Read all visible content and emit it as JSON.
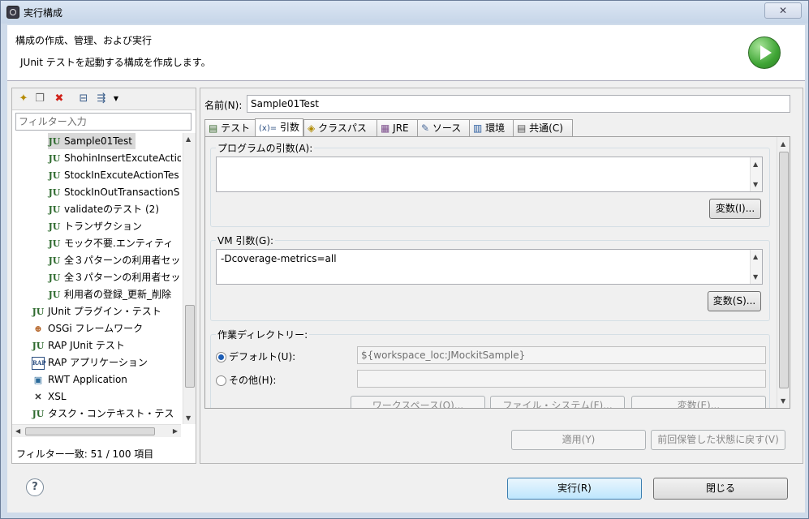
{
  "window": {
    "title": "実行構成",
    "close_label": "✕"
  },
  "header": {
    "title": "構成の作成、管理、および実行",
    "subtitle": "JUnit テストを起動する構成を作成します。"
  },
  "left": {
    "filter_placeholder": "フィルター入力",
    "tree": [
      {
        "label": "Sample01Test",
        "icon": "JU",
        "indent": 2,
        "selected": true
      },
      {
        "label": "ShohinInsertExcuteActio",
        "icon": "JU",
        "indent": 2
      },
      {
        "label": "StockInExcuteActionTes",
        "icon": "JU",
        "indent": 2
      },
      {
        "label": "StockInOutTransactionS",
        "icon": "JU",
        "indent": 2
      },
      {
        "label": "validateのテスト (2)",
        "icon": "JU",
        "indent": 2
      },
      {
        "label": "トランザクション",
        "icon": "JU",
        "indent": 2
      },
      {
        "label": "モック不要.エンティティ",
        "icon": "JU",
        "indent": 2
      },
      {
        "label": "全３パターンの利用者セッ",
        "icon": "JU",
        "indent": 2
      },
      {
        "label": "全３パターンの利用者セッ",
        "icon": "JU",
        "indent": 2
      },
      {
        "label": "利用者の登録_更新_削除",
        "icon": "JU",
        "indent": 2
      },
      {
        "label": "JUnit プラグイン・テスト",
        "icon": "JU",
        "indent": 1
      },
      {
        "label": "OSGi フレームワーク",
        "icon": "⊕",
        "indent": 1
      },
      {
        "label": "RAP JUnit テスト",
        "icon": "JU",
        "indent": 1
      },
      {
        "label": "RAP アプリケーション",
        "icon": "RAP",
        "indent": 1
      },
      {
        "label": "RWT Application",
        "icon": "▣",
        "indent": 1
      },
      {
        "label": "XSL",
        "icon": "✕",
        "indent": 1
      },
      {
        "label": "タスク・コンテキスト・テス",
        "icon": "JU",
        "indent": 1
      }
    ],
    "status": "フィルター一致: 51 / 100 項目"
  },
  "right": {
    "name_label": "名前(N):",
    "name_value": "Sample01Test",
    "tabs": [
      {
        "label": "テスト",
        "icon": "▤"
      },
      {
        "label": "引数",
        "icon": "(x)="
      },
      {
        "label": "クラスパス",
        "icon": "◈"
      },
      {
        "label": "JRE",
        "icon": "▦"
      },
      {
        "label": "ソース",
        "icon": "✎"
      },
      {
        "label": "環境",
        "icon": "▥"
      },
      {
        "label": "共通(C)",
        "icon": "▤"
      }
    ],
    "program_args_label": "プログラムの引数(A):",
    "program_args_value": "",
    "variables_button_1": "変数(I)...",
    "vm_args_label": "VM 引数(G):",
    "vm_args_value": "-Dcoverage-metrics=all",
    "variables_button_2": "変数(S)...",
    "workdir_label": "作業ディレクトリー:",
    "default_label": "デフォルト(U):",
    "default_value": "${workspace_loc:JMockitSample}",
    "other_label": "その他(H):",
    "other_value": "",
    "workspace_button": "ワークスペース(O)...",
    "filesystem_button": "ファイル・システム(F)...",
    "variables_button_3": "変数(E)...",
    "apply_button": "適用(Y)",
    "revert_button": "前回保管した状態に戻す(V)"
  },
  "footer": {
    "run_button": "実行(R)",
    "close_button": "閉じる",
    "help_icon": "?"
  }
}
